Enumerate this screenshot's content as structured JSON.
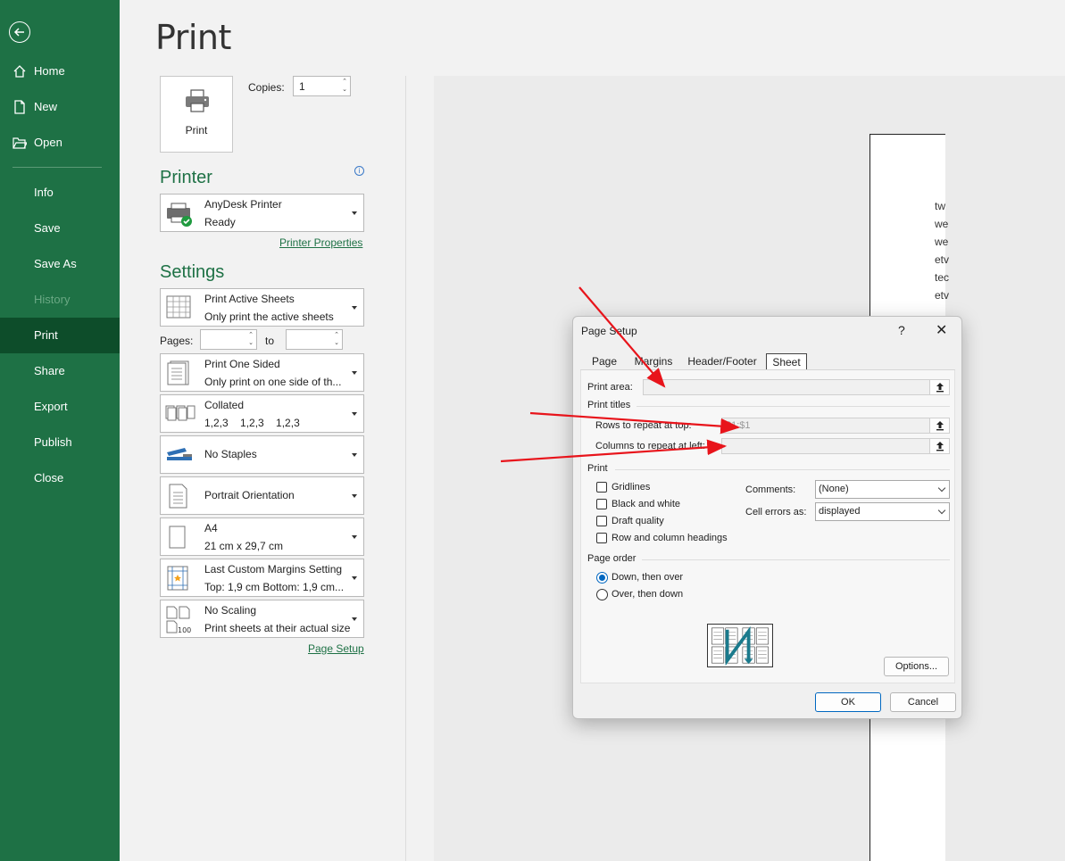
{
  "sidebar": {
    "items": [
      {
        "label": "Home"
      },
      {
        "label": "New"
      },
      {
        "label": "Open"
      },
      {
        "label": "Info"
      },
      {
        "label": "Save"
      },
      {
        "label": "Save As"
      },
      {
        "label": "History"
      },
      {
        "label": "Print"
      },
      {
        "label": "Share"
      },
      {
        "label": "Export"
      },
      {
        "label": "Publish"
      },
      {
        "label": "Close"
      }
    ]
  },
  "print": {
    "title": "Print",
    "button_label": "Print",
    "copies_label": "Copies:",
    "copies_value": "1",
    "printer_heading": "Printer",
    "printer_name": "AnyDesk Printer",
    "printer_status": "Ready",
    "printer_properties": "Printer Properties",
    "settings_heading": "Settings",
    "pages_label": "Pages:",
    "to_label": "to",
    "page_setup_link": "Page Setup",
    "settings": [
      {
        "line1": "Print Active Sheets",
        "line2": "Only print the active sheets",
        "icon": "sheets-grid-icon"
      },
      {
        "line1": "Print One Sided",
        "line2": "Only print on one side of th...",
        "icon": "one-sided-icon"
      },
      {
        "line1": "Collated",
        "line2": "1,2,3    1,2,3    1,2,3",
        "icon": "collated-icon"
      },
      {
        "line1": "No Staples",
        "line2": "",
        "icon": "stapler-icon"
      },
      {
        "line1": "Portrait Orientation",
        "line2": "",
        "icon": "portrait-icon"
      },
      {
        "line1": "A4",
        "line2": "21 cm x 29,7 cm",
        "icon": "paper-size-icon"
      },
      {
        "line1": "Last Custom Margins Setting",
        "line2": "Top: 1,9 cm Bottom: 1,9 cm...",
        "icon": "margins-icon"
      },
      {
        "line1": "No Scaling",
        "line2": "Print sheets at their actual size",
        "icon": "scaling-icon"
      }
    ]
  },
  "preview": {
    "lines": [
      "tw",
      "we",
      "we",
      "etv",
      "tec",
      "etv"
    ]
  },
  "dialog": {
    "title": "Page Setup",
    "help": "?",
    "close": "✕",
    "tabs": [
      "Page",
      "Margins",
      "Header/Footer",
      "Sheet"
    ],
    "active_tab": "Sheet",
    "print_area_label": "Print area:",
    "print_titles_label": "Print titles",
    "rows_label": "Rows to repeat at top:",
    "rows_value": "$1:$1",
    "cols_label": "Columns to repeat at left:",
    "cols_value": "",
    "print_group_label": "Print",
    "checkboxes": [
      "Gridlines",
      "Black and white",
      "Draft quality",
      "Row and column headings"
    ],
    "comments_label": "Comments:",
    "comments_value": "(None)",
    "cell_errors_label": "Cell errors as:",
    "cell_errors_value": "displayed",
    "page_order_label": "Page order",
    "order_options": [
      "Down, then over",
      "Over, then down"
    ],
    "selected_order": "Down, then over",
    "options_button": "Options...",
    "ok_button": "OK",
    "cancel_button": "Cancel"
  },
  "colors": {
    "sidebar_bg": "#1e7145",
    "sidebar_active": "#0d4d2a",
    "accent_green": "#1e7145",
    "annotation_red": "#e8141b"
  }
}
